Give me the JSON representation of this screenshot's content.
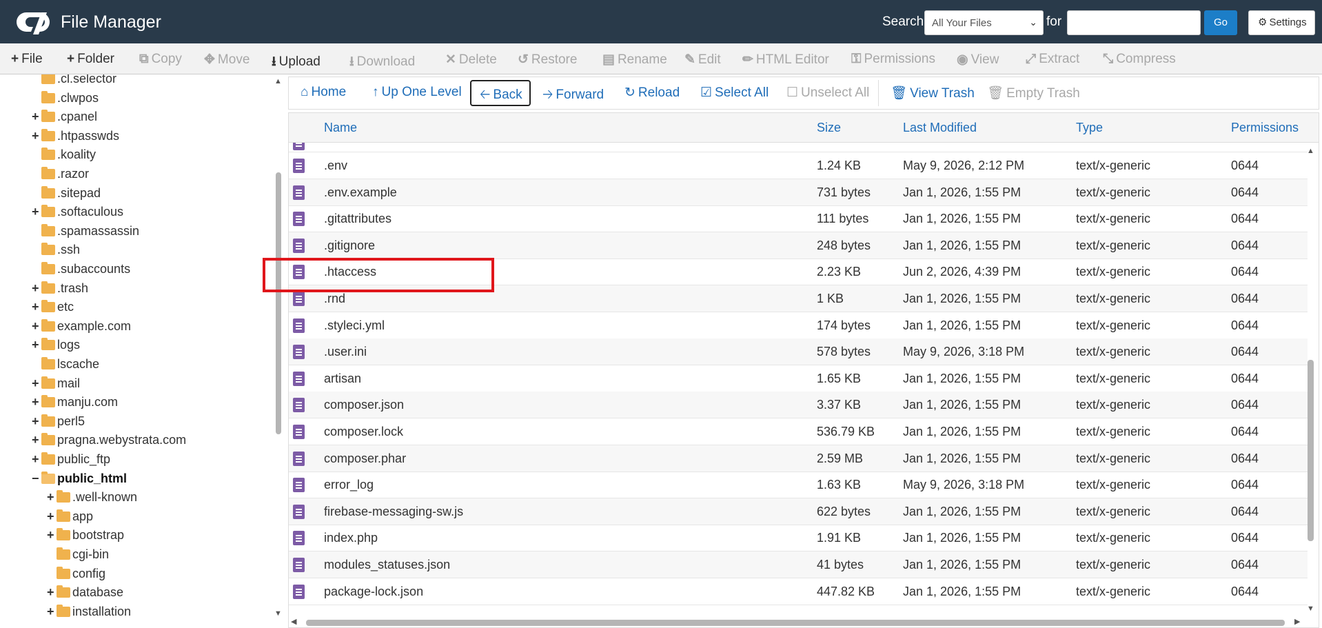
{
  "header": {
    "app_title": "File Manager",
    "search_label": "Search",
    "search_scope": "All Your Files",
    "for_label": "for",
    "search_value": "",
    "go_label": "Go",
    "settings_label": "Settings"
  },
  "toolbar": {
    "file": "File",
    "folder": "Folder",
    "copy": "Copy",
    "move": "Move",
    "upload": "Upload",
    "download": "Download",
    "delete": "Delete",
    "restore": "Restore",
    "rename": "Rename",
    "edit": "Edit",
    "html_editor": "HTML Editor",
    "permissions": "Permissions",
    "view": "View",
    "extract": "Extract",
    "compress": "Compress"
  },
  "nav": {
    "home": "Home",
    "up_one_level": "Up One Level",
    "back": "Back",
    "forward": "Forward",
    "reload": "Reload",
    "select_all": "Select All",
    "unselect_all": "Unselect All",
    "view_trash": "View Trash",
    "empty_trash": "Empty Trash"
  },
  "tree": [
    {
      "label": ".cl.selector",
      "expandable": false
    },
    {
      "label": ".clwpos",
      "expandable": false
    },
    {
      "label": ".cpanel",
      "expandable": true
    },
    {
      "label": ".htpasswds",
      "expandable": true
    },
    {
      "label": ".koality",
      "expandable": false
    },
    {
      "label": ".razor",
      "expandable": false
    },
    {
      "label": ".sitepad",
      "expandable": false
    },
    {
      "label": ".softaculous",
      "expandable": true
    },
    {
      "label": ".spamassassin",
      "expandable": false
    },
    {
      "label": ".ssh",
      "expandable": false
    },
    {
      "label": ".subaccounts",
      "expandable": false
    },
    {
      "label": ".trash",
      "expandable": true
    },
    {
      "label": "etc",
      "expandable": true
    },
    {
      "label": "example.com",
      "expandable": true
    },
    {
      "label": "logs",
      "expandable": true
    },
    {
      "label": "lscache",
      "expandable": false
    },
    {
      "label": "mail",
      "expandable": true
    },
    {
      "label": "manju.com",
      "expandable": true
    },
    {
      "label": "perl5",
      "expandable": true
    },
    {
      "label": "pragna.webystrata.com",
      "expandable": true
    },
    {
      "label": "public_ftp",
      "expandable": true
    },
    {
      "label": "public_html",
      "expandable": true,
      "expanded": true,
      "selected": true
    },
    {
      "label": ".well-known",
      "expandable": true,
      "child": true
    },
    {
      "label": "app",
      "expandable": true,
      "child": true
    },
    {
      "label": "bootstrap",
      "expandable": true,
      "child": true
    },
    {
      "label": "cgi-bin",
      "expandable": false,
      "child": true
    },
    {
      "label": "config",
      "expandable": false,
      "child": true
    },
    {
      "label": "database",
      "expandable": true,
      "child": true
    },
    {
      "label": "installation",
      "expandable": true,
      "child": true
    }
  ],
  "table": {
    "columns": [
      "Name",
      "Size",
      "Last Modified",
      "Type",
      "Permissions"
    ],
    "rows": [
      {
        "name": ".env",
        "size": "1.24 KB",
        "modified": "May 9, 2026, 2:12 PM",
        "type": "text/x-generic",
        "perms": "0644"
      },
      {
        "name": ".env.example",
        "size": "731 bytes",
        "modified": "Jan 1, 2026, 1:55 PM",
        "type": "text/x-generic",
        "perms": "0644"
      },
      {
        "name": ".gitattributes",
        "size": "111 bytes",
        "modified": "Jan 1, 2026, 1:55 PM",
        "type": "text/x-generic",
        "perms": "0644"
      },
      {
        "name": ".gitignore",
        "size": "248 bytes",
        "modified": "Jan 1, 2026, 1:55 PM",
        "type": "text/x-generic",
        "perms": "0644"
      },
      {
        "name": ".htaccess",
        "size": "2.23 KB",
        "modified": "Jun 2, 2026, 4:39 PM",
        "type": "text/x-generic",
        "perms": "0644"
      },
      {
        "name": ".rnd",
        "size": "1 KB",
        "modified": "Jan 1, 2026, 1:55 PM",
        "type": "text/x-generic",
        "perms": "0644"
      },
      {
        "name": ".styleci.yml",
        "size": "174 bytes",
        "modified": "Jan 1, 2026, 1:55 PM",
        "type": "text/x-generic",
        "perms": "0644"
      },
      {
        "name": ".user.ini",
        "size": "578 bytes",
        "modified": "May 9, 2026, 3:18 PM",
        "type": "text/x-generic",
        "perms": "0644"
      },
      {
        "name": "artisan",
        "size": "1.65 KB",
        "modified": "Jan 1, 2026, 1:55 PM",
        "type": "text/x-generic",
        "perms": "0644"
      },
      {
        "name": "composer.json",
        "size": "3.37 KB",
        "modified": "Jan 1, 2026, 1:55 PM",
        "type": "text/x-generic",
        "perms": "0644"
      },
      {
        "name": "composer.lock",
        "size": "536.79 KB",
        "modified": "Jan 1, 2026, 1:55 PM",
        "type": "text/x-generic",
        "perms": "0644"
      },
      {
        "name": "composer.phar",
        "size": "2.59 MB",
        "modified": "Jan 1, 2026, 1:55 PM",
        "type": "text/x-generic",
        "perms": "0644"
      },
      {
        "name": "error_log",
        "size": "1.63 KB",
        "modified": "May 9, 2026, 3:18 PM",
        "type": "text/x-generic",
        "perms": "0644"
      },
      {
        "name": "firebase-messaging-sw.js",
        "size": "622 bytes",
        "modified": "Jan 1, 2026, 1:55 PM",
        "type": "text/x-generic",
        "perms": "0644"
      },
      {
        "name": "index.php",
        "size": "1.91 KB",
        "modified": "Jan 1, 2026, 1:55 PM",
        "type": "text/x-generic",
        "perms": "0644"
      },
      {
        "name": "modules_statuses.json",
        "size": "41 bytes",
        "modified": "Jan 1, 2026, 1:55 PM",
        "type": "text/x-generic",
        "perms": "0644"
      },
      {
        "name": "package-lock.json",
        "size": "447.82 KB",
        "modified": "Jan 1, 2026, 1:55 PM",
        "type": "text/x-generic",
        "perms": "0644"
      }
    ]
  },
  "colors": {
    "header_bg": "#293a4a",
    "link_blue": "#1f6db8",
    "highlight_red": "#e0161b",
    "file_icon_purple": "#7d5ba6",
    "folder_orange": "#f0b24d"
  }
}
